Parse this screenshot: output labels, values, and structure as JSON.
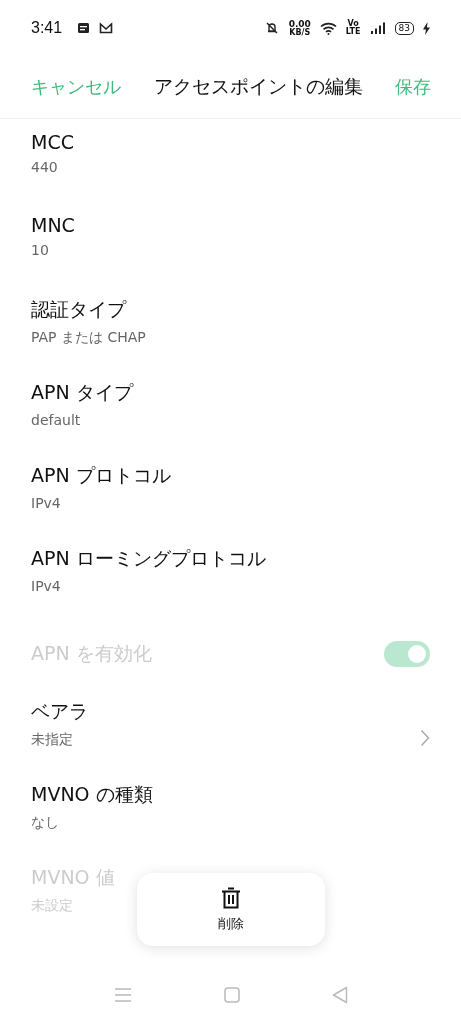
{
  "status_bar": {
    "time": "3:41",
    "net_speed": "0.00",
    "net_unit": "KB/S",
    "volte_top": "Vo",
    "volte_bottom": "LTE",
    "battery": "83"
  },
  "header": {
    "cancel": "キャンセル",
    "title": "アクセスポイントの編集",
    "save": "保存"
  },
  "settings": [
    {
      "kind": "text",
      "title": "MCC",
      "value": "440",
      "disabled": false
    },
    {
      "kind": "text",
      "title": "MNC",
      "value": "10",
      "disabled": false
    },
    {
      "kind": "text",
      "title": "認証タイプ",
      "value": "PAP または CHAP",
      "disabled": false
    },
    {
      "kind": "text",
      "title": "APN タイプ",
      "value": "default",
      "disabled": false
    },
    {
      "kind": "text",
      "title": "APN プロトコル",
      "value": "IPv4",
      "disabled": false
    },
    {
      "kind": "text",
      "title": "APN ローミングプロトコル",
      "value": "IPv4",
      "disabled": false
    },
    {
      "kind": "switch",
      "title": "APN を有効化",
      "on": true,
      "disabled": true
    },
    {
      "kind": "chevron",
      "title": "ベアラ",
      "value": "未指定",
      "disabled": false
    },
    {
      "kind": "text",
      "title": "MVNO の種類",
      "value": "なし",
      "disabled": false
    },
    {
      "kind": "text",
      "title": "MVNO 値",
      "value": "未設定",
      "disabled": true
    }
  ],
  "delete_button": {
    "label": "削除"
  }
}
